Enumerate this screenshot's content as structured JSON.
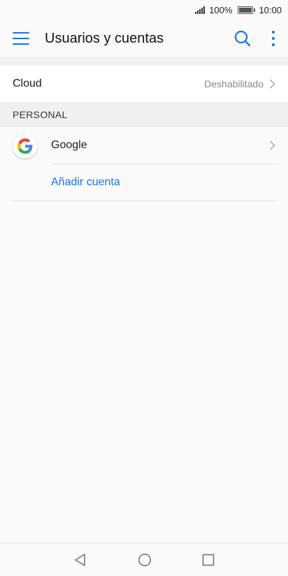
{
  "status_bar": {
    "battery_level": "100%",
    "time": "10:00"
  },
  "toolbar": {
    "title": "Usuarios y cuentas"
  },
  "cloud": {
    "label": "Cloud",
    "value": "Deshabilitado"
  },
  "personal": {
    "header": "PERSONAL",
    "accounts": [
      {
        "label": "Google",
        "icon": "google-logo-icon"
      }
    ],
    "add_account_label": "Añadir cuenta"
  },
  "colors": {
    "accent": "#1a73e8",
    "background": "#fafafa",
    "section_header_bg": "#f0f0f0"
  }
}
